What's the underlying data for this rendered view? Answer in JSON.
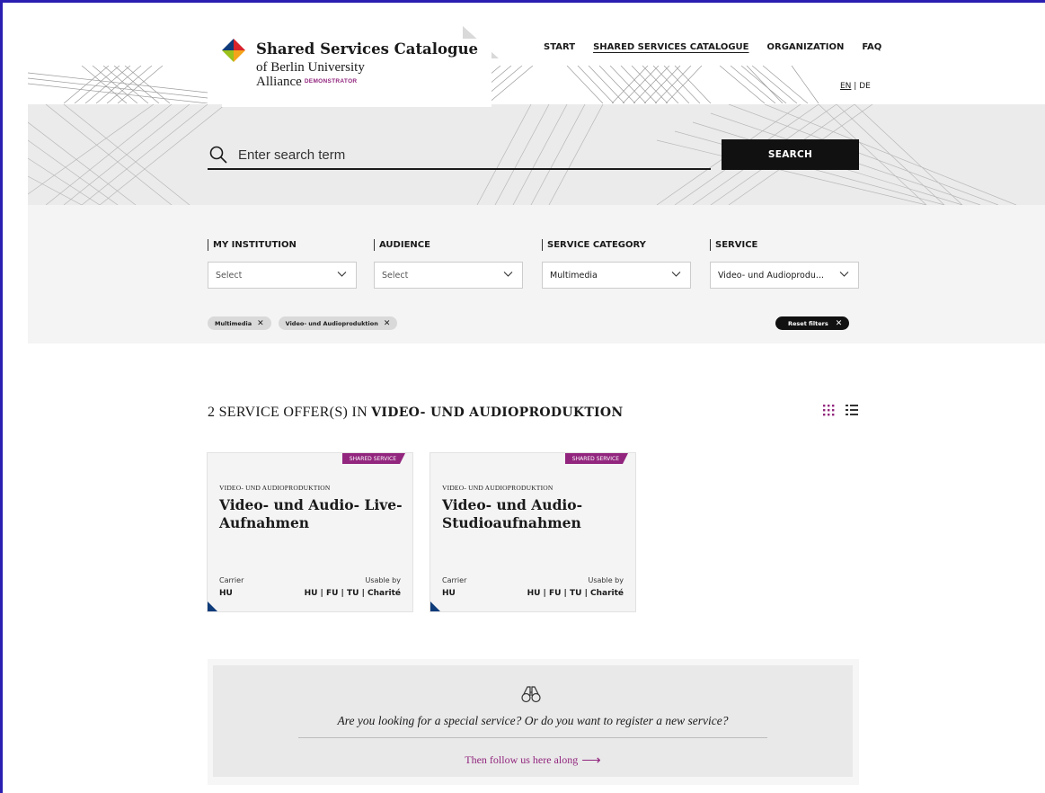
{
  "brand": {
    "title": "Shared Services Catalogue",
    "subtitle_line1": "of Berlin University",
    "subtitle_line2": "Alliance",
    "badge": "DEMONSTRATOR",
    "colors": {
      "accent": "#92267e",
      "navy": "#0e3b7a",
      "frame": "#2a1fb0"
    }
  },
  "nav": {
    "items": [
      {
        "label": "START"
      },
      {
        "label": "SHARED SERVICES CATALOGUE"
      },
      {
        "label": "ORGANIZATION"
      },
      {
        "label": "FAQ"
      }
    ],
    "active": "SHARED SERVICES CATALOGUE"
  },
  "lang": {
    "en": "EN",
    "separator": "|",
    "de": "DE",
    "active": "EN"
  },
  "search": {
    "placeholder": "Enter search term",
    "button": "SEARCH",
    "icon": "search-icon"
  },
  "filters": [
    {
      "label": "MY INSTITUTION",
      "value": "Select"
    },
    {
      "label": "AUDIENCE",
      "value": "Select"
    },
    {
      "label": "SERVICE CATEGORY",
      "value": "Multimedia"
    },
    {
      "label": "SERVICE",
      "value": "Video- und Audioprodu..."
    }
  ],
  "chips": [
    {
      "label": "Multimedia"
    },
    {
      "label": "Video- und Audioproduktion"
    }
  ],
  "reset_label": "Reset filters",
  "results": {
    "count_text": "2 SERVICE OFFER(S) IN",
    "category": "VIDEO- UND AUDIOPRODUKTION",
    "view_modes": [
      "grid-view-icon",
      "list-view-icon"
    ]
  },
  "cards": [
    {
      "badge": "SHARED SERVICE",
      "category": "VIDEO- UND AUDIOPRODUKTION",
      "title": "Video- und Audio- Live-Aufnahmen",
      "carrier_label": "Carrier",
      "carrier": "HU",
      "usable_label": "Usable by",
      "usable": "HU | FU | TU | Charité"
    },
    {
      "badge": "SHARED SERVICE",
      "category": "VIDEO- UND AUDIOPRODUKTION",
      "title": "Video- und Audio-Studioaufnahmen",
      "carrier_label": "Carrier",
      "carrier": "HU",
      "usable_label": "Usable by",
      "usable": "HU | FU | TU | Charité"
    }
  ],
  "cta": {
    "icon": "binoculars-icon",
    "text": "Are you looking for a special service? Or do you want to register a new service?",
    "link": "Then follow us here along",
    "arrow": "⟶"
  }
}
